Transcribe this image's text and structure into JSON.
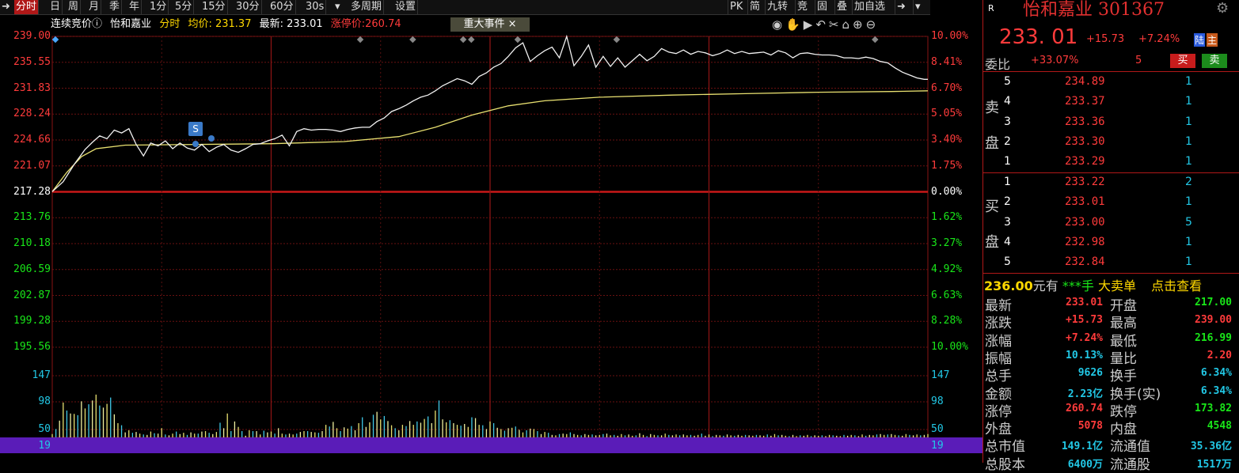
{
  "toolbar": {
    "tabs": [
      "分时",
      "日",
      "周",
      "月",
      "季",
      "年",
      "1分",
      "5分",
      "15分",
      "30分",
      "60分",
      "30s",
      "多周期",
      "设置"
    ],
    "right_tabs": [
      "PK",
      "简",
      "九转",
      "竞",
      "固",
      "叠",
      "加自选"
    ]
  },
  "info": {
    "auction": "连续竞价ⓘ",
    "name": "怡和嘉业",
    "mode": "分时",
    "avg": "均价: 231.37",
    "latest": "最新: 233.01",
    "limit_up": "涨停价:260.74",
    "event_button": "重大事件 ×"
  },
  "marker": "S",
  "chart_data": {
    "type": "line",
    "price_axis": [
      "239.00",
      "235.55",
      "231.83",
      "228.24",
      "224.66",
      "221.07",
      "217.28",
      "213.76",
      "210.18",
      "206.59",
      "202.87",
      "199.28",
      "195.56"
    ],
    "pct_axis": [
      "10.00%",
      "8.41%",
      "6.70%",
      "5.05%",
      "3.40%",
      "1.75%",
      "0.00%",
      "1.62%",
      "3.27%",
      "4.92%",
      "6.63%",
      "8.28%",
      "10.00%"
    ],
    "vol_axis_left": [
      "147",
      "98",
      "50",
      "19"
    ],
    "vol_axis_right": [
      "147",
      "98",
      "50",
      "19"
    ],
    "prev_close": 217.28,
    "ylim": [
      195.56,
      239.0
    ],
    "price_series": [
      [
        0,
        217.3
      ],
      [
        3,
        218.7
      ],
      [
        6,
        221.1
      ],
      [
        9,
        223.2
      ],
      [
        11,
        224.2
      ],
      [
        13,
        225.1
      ],
      [
        15,
        224.7
      ],
      [
        17,
        225.9
      ],
      [
        19,
        225.5
      ],
      [
        21,
        226.1
      ],
      [
        23,
        223.9
      ],
      [
        25,
        222.3
      ],
      [
        27,
        224.1
      ],
      [
        29,
        223.7
      ],
      [
        31,
        224.4
      ],
      [
        33,
        223.3
      ],
      [
        35,
        224.1
      ],
      [
        37,
        223.4
      ],
      [
        39,
        223.1
      ],
      [
        41,
        223.9
      ],
      [
        43,
        222.9
      ],
      [
        45,
        223.5
      ],
      [
        47,
        223.9
      ],
      [
        49,
        223.1
      ],
      [
        51,
        222.8
      ],
      [
        53,
        223.3
      ],
      [
        55,
        223.9
      ],
      [
        57,
        224.0
      ],
      [
        59,
        224.4
      ],
      [
        61,
        224.7
      ],
      [
        63,
        225.2
      ],
      [
        65,
        223.7
      ],
      [
        67,
        225.7
      ],
      [
        69,
        226.1
      ],
      [
        71,
        225.9
      ],
      [
        73,
        226.0
      ],
      [
        75,
        226.0
      ],
      [
        77,
        225.9
      ],
      [
        79,
        225.7
      ],
      [
        81,
        226.0
      ],
      [
        83,
        226.2
      ],
      [
        85,
        226.3
      ],
      [
        87,
        226.3
      ],
      [
        89,
        227.1
      ],
      [
        91,
        227.6
      ],
      [
        93,
        228.5
      ],
      [
        95,
        228.9
      ],
      [
        97,
        229.4
      ],
      [
        99,
        230.0
      ],
      [
        101,
        230.5
      ],
      [
        103,
        230.8
      ],
      [
        105,
        231.4
      ],
      [
        107,
        232.1
      ],
      [
        109,
        232.6
      ],
      [
        111,
        233.1
      ],
      [
        113,
        232.8
      ],
      [
        115,
        232.3
      ],
      [
        117,
        233.4
      ],
      [
        119,
        233.9
      ],
      [
        121,
        234.7
      ],
      [
        123,
        235.2
      ],
      [
        125,
        236.2
      ],
      [
        127,
        237.4
      ],
      [
        129,
        238.1
      ],
      [
        131,
        235.5
      ],
      [
        133,
        236.3
      ],
      [
        135,
        237.0
      ],
      [
        137,
        237.5
      ],
      [
        139,
        236.0
      ],
      [
        141,
        239.0
      ],
      [
        143,
        234.9
      ],
      [
        145,
        236.2
      ],
      [
        147,
        237.8
      ],
      [
        149,
        234.7
      ],
      [
        151,
        236.2
      ],
      [
        153,
        234.8
      ],
      [
        155,
        236.0
      ],
      [
        157,
        234.7
      ],
      [
        159,
        235.6
      ],
      [
        161,
        236.5
      ],
      [
        163,
        235.6
      ],
      [
        165,
        236.2
      ],
      [
        167,
        237.3
      ],
      [
        169,
        236.8
      ],
      [
        171,
        236.6
      ],
      [
        173,
        237.1
      ],
      [
        175,
        236.5
      ],
      [
        177,
        236.9
      ],
      [
        179,
        236.7
      ],
      [
        181,
        236.3
      ],
      [
        183,
        236.6
      ],
      [
        185,
        237.1
      ],
      [
        187,
        236.6
      ],
      [
        189,
        236.9
      ],
      [
        191,
        236.6
      ],
      [
        193,
        236.7
      ],
      [
        195,
        236.8
      ],
      [
        197,
        236.4
      ],
      [
        199,
        237.0
      ],
      [
        201,
        236.7
      ],
      [
        203,
        236.0
      ],
      [
        205,
        236.6
      ],
      [
        207,
        236.7
      ],
      [
        209,
        236.5
      ],
      [
        211,
        236.4
      ],
      [
        213,
        236.4
      ],
      [
        215,
        236.3
      ],
      [
        217,
        236.0
      ],
      [
        219,
        236.0
      ],
      [
        221,
        235.9
      ],
      [
        223,
        236.1
      ],
      [
        225,
        235.9
      ],
      [
        227,
        235.5
      ],
      [
        229,
        235.3
      ],
      [
        231,
        234.6
      ],
      [
        233,
        234.0
      ],
      [
        235,
        233.6
      ],
      [
        237,
        233.2
      ],
      [
        239,
        233.0
      ],
      [
        240,
        233.0
      ]
    ],
    "avg_series": [
      [
        0,
        217.3
      ],
      [
        4,
        220.0
      ],
      [
        8,
        222.2
      ],
      [
        12,
        223.3
      ],
      [
        20,
        223.8
      ],
      [
        40,
        223.9
      ],
      [
        60,
        224.0
      ],
      [
        80,
        224.3
      ],
      [
        95,
        225.0
      ],
      [
        105,
        226.3
      ],
      [
        115,
        228.0
      ],
      [
        125,
        229.3
      ],
      [
        135,
        230.0
      ],
      [
        150,
        230.5
      ],
      [
        170,
        230.8
      ],
      [
        190,
        231.0
      ],
      [
        210,
        231.2
      ],
      [
        230,
        231.3
      ],
      [
        240,
        231.4
      ]
    ],
    "volume_series": [
      [
        0,
        8
      ],
      [
        1,
        20
      ],
      [
        2,
        40
      ],
      [
        3,
        83
      ],
      [
        4,
        64
      ],
      [
        5,
        57
      ],
      [
        6,
        56
      ],
      [
        7,
        53
      ],
      [
        8,
        86
      ],
      [
        9,
        69
      ],
      [
        10,
        79
      ],
      [
        11,
        88
      ],
      [
        12,
        102
      ],
      [
        13,
        76
      ],
      [
        14,
        71
      ],
      [
        15,
        80
      ],
      [
        16,
        95
      ],
      [
        17,
        55
      ],
      [
        18,
        34
      ],
      [
        19,
        29
      ],
      [
        20,
        12
      ],
      [
        21,
        17
      ],
      [
        22,
        11
      ],
      [
        23,
        13
      ],
      [
        24,
        9
      ],
      [
        25,
        7
      ],
      [
        26,
        6
      ],
      [
        27,
        14
      ],
      [
        28,
        10
      ],
      [
        29,
        9
      ],
      [
        30,
        22
      ],
      [
        31,
        7
      ],
      [
        32,
        5
      ],
      [
        33,
        9
      ],
      [
        34,
        14
      ],
      [
        35,
        8
      ],
      [
        36,
        11
      ],
      [
        37,
        6
      ],
      [
        38,
        12
      ],
      [
        39,
        9
      ],
      [
        40,
        9
      ],
      [
        41,
        14
      ],
      [
        42,
        15
      ],
      [
        43,
        11
      ],
      [
        44,
        8
      ],
      [
        45,
        13
      ],
      [
        46,
        35
      ],
      [
        47,
        22
      ],
      [
        48,
        57
      ],
      [
        49,
        15
      ],
      [
        50,
        38
      ],
      [
        51,
        25
      ],
      [
        52,
        15
      ],
      [
        53,
        4
      ],
      [
        54,
        17
      ],
      [
        55,
        15
      ],
      [
        56,
        15
      ],
      [
        57,
        7
      ],
      [
        58,
        16
      ],
      [
        59,
        12
      ],
      [
        60,
        14
      ],
      [
        61,
        9
      ],
      [
        62,
        22
      ],
      [
        63,
        9
      ],
      [
        64,
        7
      ],
      [
        65,
        9
      ],
      [
        66,
        7
      ],
      [
        67,
        9
      ],
      [
        68,
        13
      ],
      [
        69,
        15
      ],
      [
        70,
        15
      ],
      [
        71,
        13
      ],
      [
        72,
        12
      ],
      [
        73,
        11
      ],
      [
        74,
        15
      ],
      [
        75,
        30
      ],
      [
        76,
        26
      ],
      [
        77,
        37
      ],
      [
        78,
        22
      ],
      [
        79,
        15
      ],
      [
        80,
        24
      ],
      [
        81,
        21
      ],
      [
        82,
        27
      ],
      [
        83,
        17
      ],
      [
        84,
        34
      ],
      [
        85,
        48
      ],
      [
        86,
        25
      ],
      [
        87,
        36
      ],
      [
        88,
        54
      ],
      [
        89,
        61
      ],
      [
        90,
        43
      ],
      [
        91,
        51
      ],
      [
        92,
        39
      ],
      [
        93,
        29
      ],
      [
        94,
        22
      ],
      [
        95,
        17
      ],
      [
        96,
        30
      ],
      [
        97,
        27
      ],
      [
        98,
        39
      ],
      [
        99,
        30
      ],
      [
        100,
        38
      ],
      [
        101,
        35
      ],
      [
        102,
        44
      ],
      [
        103,
        50
      ],
      [
        104,
        34
      ],
      [
        105,
        64
      ],
      [
        106,
        88
      ],
      [
        107,
        43
      ],
      [
        108,
        36
      ],
      [
        109,
        41
      ],
      [
        110,
        34
      ],
      [
        111,
        30
      ],
      [
        112,
        28
      ],
      [
        113,
        32
      ],
      [
        114,
        25
      ],
      [
        115,
        48
      ],
      [
        116,
        46
      ],
      [
        117,
        30
      ],
      [
        118,
        29
      ],
      [
        119,
        20
      ],
      [
        120,
        38
      ],
      [
        121,
        34
      ],
      [
        122,
        23
      ],
      [
        123,
        20
      ],
      [
        124,
        16
      ],
      [
        125,
        22
      ],
      [
        126,
        23
      ],
      [
        127,
        26
      ],
      [
        128,
        18
      ],
      [
        129,
        12
      ],
      [
        130,
        17
      ],
      [
        131,
        21
      ],
      [
        132,
        20
      ],
      [
        133,
        15
      ],
      [
        134,
        8
      ],
      [
        135,
        13
      ],
      [
        136,
        11
      ],
      [
        137,
        6
      ],
      [
        138,
        5
      ],
      [
        139,
        8
      ],
      [
        140,
        9
      ],
      [
        141,
        8
      ],
      [
        142,
        12
      ],
      [
        143,
        8
      ],
      [
        144,
        6
      ],
      [
        145,
        5
      ],
      [
        146,
        8
      ],
      [
        147,
        6
      ],
      [
        148,
        7
      ],
      [
        149,
        5
      ],
      [
        150,
        6
      ],
      [
        151,
        8
      ],
      [
        152,
        9
      ],
      [
        153,
        5
      ],
      [
        154,
        6
      ],
      [
        155,
        4
      ],
      [
        156,
        8
      ],
      [
        157,
        5
      ],
      [
        158,
        7
      ],
      [
        159,
        4
      ],
      [
        160,
        5
      ],
      [
        161,
        10
      ],
      [
        162,
        6
      ],
      [
        163,
        3
      ],
      [
        164,
        8
      ],
      [
        165,
        6
      ],
      [
        166,
        5
      ],
      [
        167,
        5
      ],
      [
        168,
        9
      ],
      [
        169,
        6
      ],
      [
        170,
        5
      ],
      [
        171,
        7
      ],
      [
        172,
        5
      ],
      [
        173,
        7
      ],
      [
        174,
        5
      ],
      [
        175,
        6
      ],
      [
        176,
        4
      ],
      [
        177,
        6
      ],
      [
        178,
        9
      ],
      [
        179,
        4
      ],
      [
        180,
        7
      ],
      [
        181,
        3
      ],
      [
        182,
        6
      ],
      [
        183,
        5
      ],
      [
        184,
        4
      ],
      [
        185,
        7
      ],
      [
        186,
        5
      ],
      [
        187,
        4
      ],
      [
        188,
        6
      ],
      [
        189,
        4
      ],
      [
        190,
        6
      ],
      [
        191,
        5
      ],
      [
        192,
        4
      ],
      [
        193,
        6
      ],
      [
        194,
        5
      ],
      [
        195,
        4
      ],
      [
        196,
        7
      ],
      [
        197,
        4
      ],
      [
        198,
        8
      ],
      [
        199,
        5
      ],
      [
        200,
        6
      ],
      [
        201,
        4
      ],
      [
        202,
        3
      ],
      [
        203,
        6
      ],
      [
        204,
        3
      ],
      [
        205,
        5
      ],
      [
        206,
        4
      ],
      [
        207,
        6
      ],
      [
        208,
        3
      ],
      [
        209,
        5
      ],
      [
        210,
        4
      ],
      [
        211,
        5
      ],
      [
        212,
        3
      ],
      [
        213,
        6
      ],
      [
        214,
        5
      ],
      [
        215,
        4
      ],
      [
        216,
        3
      ],
      [
        217,
        6
      ],
      [
        218,
        4
      ],
      [
        219,
        6
      ],
      [
        220,
        5
      ],
      [
        221,
        3
      ],
      [
        222,
        7
      ],
      [
        223,
        4
      ],
      [
        224,
        6
      ],
      [
        225,
        5
      ],
      [
        226,
        7
      ],
      [
        227,
        8
      ],
      [
        228,
        6
      ],
      [
        229,
        7
      ],
      [
        230,
        8
      ],
      [
        231,
        6
      ],
      [
        232,
        5
      ],
      [
        233,
        4
      ],
      [
        234,
        8
      ],
      [
        235,
        6
      ],
      [
        236,
        5
      ],
      [
        237,
        7
      ],
      [
        238,
        5
      ],
      [
        239,
        6
      ],
      [
        240,
        8
      ]
    ]
  },
  "side": {
    "r_badge": "R",
    "title": "怡和嘉业 301367",
    "gear": "⚙",
    "price": "233. 01",
    "change": "+15.73",
    "change_pct": "+7.24%",
    "lu": "陆",
    "zhu": "主",
    "weibi_label": "委比",
    "weibi_val": "+33.07%",
    "weibi_num": "5",
    "buy_btn": "买",
    "sell_btn": "卖",
    "sell_label_1": "卖",
    "sell_label_2": "盘",
    "buy_label_1": "买",
    "buy_label_2": "盘",
    "sell_orders": [
      {
        "lvl": "5",
        "price": "234.89",
        "vol": "1"
      },
      {
        "lvl": "4",
        "price": "233.37",
        "vol": "1"
      },
      {
        "lvl": "3",
        "price": "233.36",
        "vol": "1"
      },
      {
        "lvl": "2",
        "price": "233.30",
        "vol": "1"
      },
      {
        "lvl": "1",
        "price": "233.29",
        "vol": "1"
      }
    ],
    "buy_orders": [
      {
        "lvl": "1",
        "price": "233.22",
        "vol": "2"
      },
      {
        "lvl": "2",
        "price": "233.01",
        "vol": "1"
      },
      {
        "lvl": "3",
        "price": "233.00",
        "vol": "5"
      },
      {
        "lvl": "4",
        "price": "232.98",
        "vol": "1"
      },
      {
        "lvl": "5",
        "price": "232.84",
        "vol": "1"
      }
    ],
    "big_order": {
      "price": "236.00",
      "text1": "元有",
      "text2": "***手",
      "text3": "大卖单",
      "link": "点击查看"
    },
    "stats": [
      {
        "l1": "最新",
        "v1": "233.01",
        "c1": "red",
        "l2": "开盘",
        "v2": "217.00",
        "c2": "green"
      },
      {
        "l1": "涨跌",
        "v1": "+15.73",
        "c1": "red",
        "l2": "最高",
        "v2": "239.00",
        "c2": "red"
      },
      {
        "l1": "涨幅",
        "v1": "+7.24%",
        "c1": "red",
        "l2": "最低",
        "v2": "216.99",
        "c2": "green"
      },
      {
        "l1": "振幅",
        "v1": "10.13%",
        "c1": "cyan",
        "l2": "量比",
        "v2": "2.20",
        "c2": "red"
      },
      {
        "l1": "总手",
        "v1": "9626",
        "c1": "cyan",
        "l2": "换手",
        "v2": "6.34%",
        "c2": "cyan"
      },
      {
        "l1": "金额",
        "v1": "2.23亿",
        "c1": "cyan",
        "l2": "换手(实)",
        "v2": "6.34%",
        "c2": "cyan"
      },
      {
        "l1": "涨停",
        "v1": "260.74",
        "c1": "red",
        "l2": "跌停",
        "v2": "173.82",
        "c2": "green"
      },
      {
        "l1": "外盘",
        "v1": "5078",
        "c1": "red",
        "l2": "内盘",
        "v2": "4548",
        "c2": "green"
      },
      {
        "l1": "总市值",
        "v1": "149.1亿",
        "c1": "cyan",
        "l2": "流通值",
        "v2": "35.36亿",
        "c2": "cyan"
      },
      {
        "l1": "总股本",
        "v1": "6400万",
        "c1": "cyan",
        "l2": "流通股",
        "v2": "1517万",
        "c2": "cyan"
      }
    ]
  }
}
